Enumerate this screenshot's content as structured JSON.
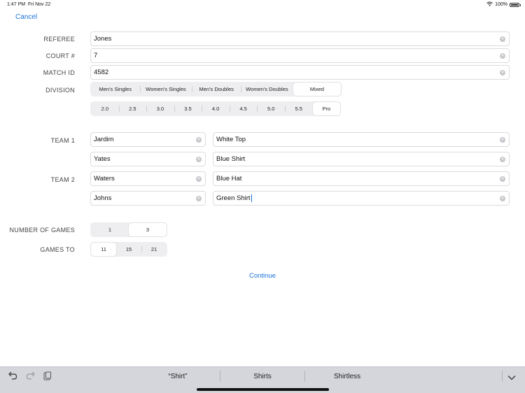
{
  "status": {
    "time": "1:47 PM",
    "date": "Fri Nov 22",
    "battery": "100%"
  },
  "nav": {
    "cancel": "Cancel"
  },
  "labels": {
    "referee": "REFEREE",
    "court": "COURT #",
    "match_id": "MATCH ID",
    "division": "DIVISION",
    "team1": "TEAM 1",
    "team2": "TEAM 2",
    "num_games": "NUMBER OF GAMES",
    "games_to": "GAMES TO"
  },
  "fields": {
    "referee": "Jones",
    "court": "7",
    "match_id": "4582"
  },
  "division": {
    "options": [
      "Men's Singles",
      "Women's Singles",
      "Men's Doubles",
      "Women's Doubles",
      "Mixed"
    ],
    "selected": "Mixed"
  },
  "rating": {
    "options": [
      "2.0",
      "2.5",
      "3.0",
      "3.5",
      "4.0",
      "4.5",
      "5.0",
      "5.5",
      "Pro"
    ],
    "selected": "Pro"
  },
  "team1": {
    "player1": {
      "name": "Jardim",
      "desc": "White Top"
    },
    "player2": {
      "name": "Yates",
      "desc": "Blue Shirt"
    }
  },
  "team2": {
    "player1": {
      "name": "Waters",
      "desc": "Blue Hat"
    },
    "player2": {
      "name": "Johns",
      "desc": "Green Shirt"
    }
  },
  "number_of_games": {
    "options": [
      "1",
      "3"
    ],
    "selected": "3"
  },
  "games_to": {
    "options": [
      "11",
      "15",
      "21"
    ],
    "selected": "11"
  },
  "actions": {
    "continue": "Continue"
  },
  "keyboard": {
    "suggestions": [
      "“Shirt”",
      "Shirts",
      "Shirtless"
    ],
    "undo_icon": "undo-icon",
    "redo_icon": "redo-icon",
    "paste_icon": "paste-icon",
    "dismiss_icon": "chevron-down-icon"
  },
  "colors": {
    "accent": "#1a73d9",
    "segment_bg": "#eeeef0",
    "keyboard_bg": "#d4d6db"
  }
}
